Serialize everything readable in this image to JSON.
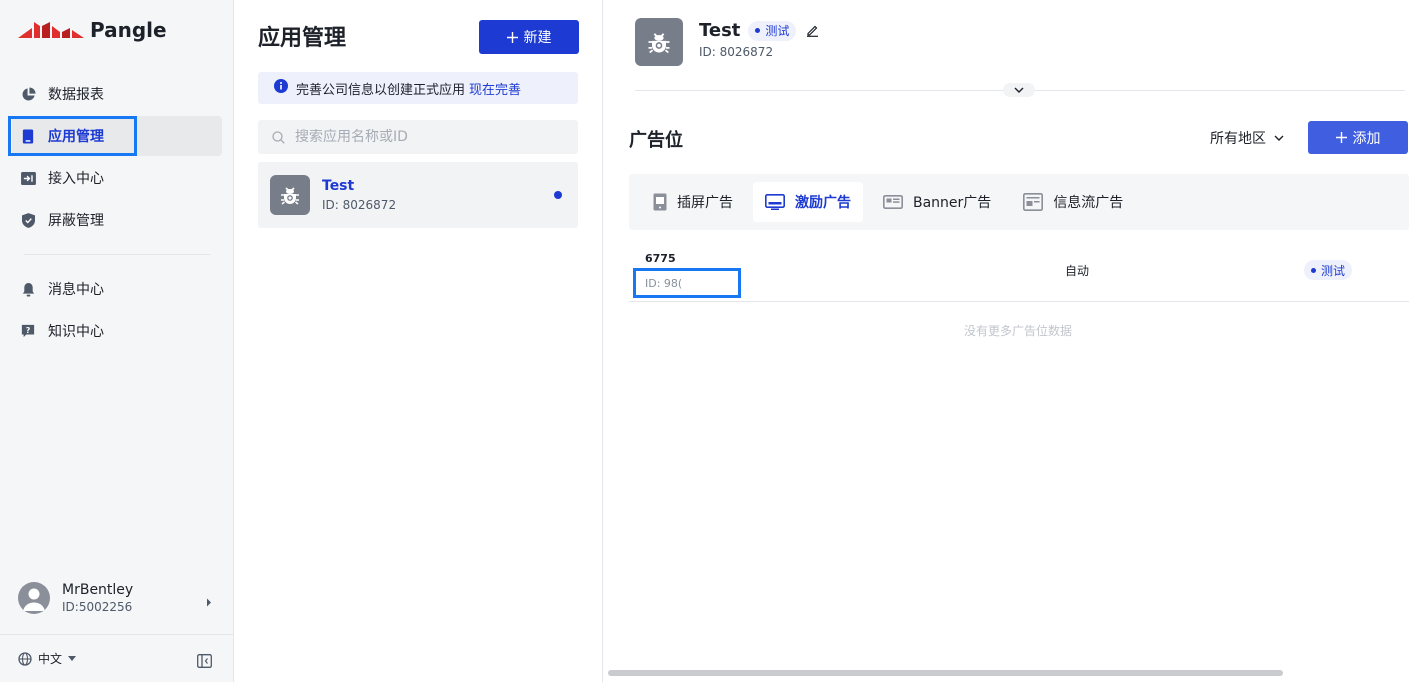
{
  "brand": {
    "logo_text": "Pangle"
  },
  "sidebar": {
    "items": [
      {
        "label": "数据报表"
      },
      {
        "label": "应用管理"
      },
      {
        "label": "接入中心"
      },
      {
        "label": "屏蔽管理"
      },
      {
        "label": "消息中心"
      },
      {
        "label": "知识中心"
      }
    ],
    "user": {
      "name": "MrBentley",
      "id": "ID:5002256"
    },
    "language": "中文"
  },
  "apps_panel": {
    "title": "应用管理",
    "new_button": "新建",
    "notice_text": "完善公司信息以创建正式应用",
    "notice_link": "现在完善",
    "search_placeholder": "搜索应用名称或ID",
    "apps": [
      {
        "name": "Test",
        "id": "ID: 8026872"
      }
    ]
  },
  "detail": {
    "app_name": "Test",
    "app_badge": "测试",
    "app_id": "ID: 8026872",
    "section_title": "广告位",
    "region_filter": "所有地区",
    "add_button": "添加",
    "tabs": [
      {
        "label": "插屏广告"
      },
      {
        "label": "激励广告"
      },
      {
        "label": "Banner广告"
      },
      {
        "label": "信息流广告"
      }
    ],
    "slots": [
      {
        "name": "6775",
        "id": "ID: 98(",
        "mode": "自动",
        "badge": "测试"
      }
    ],
    "empty_text": "没有更多广告位数据"
  },
  "colors": {
    "primary": "#1d3ad2",
    "add_button": "#3f5fe0",
    "highlight_box": "#1877f2",
    "logo_red": "#e02f2f"
  }
}
